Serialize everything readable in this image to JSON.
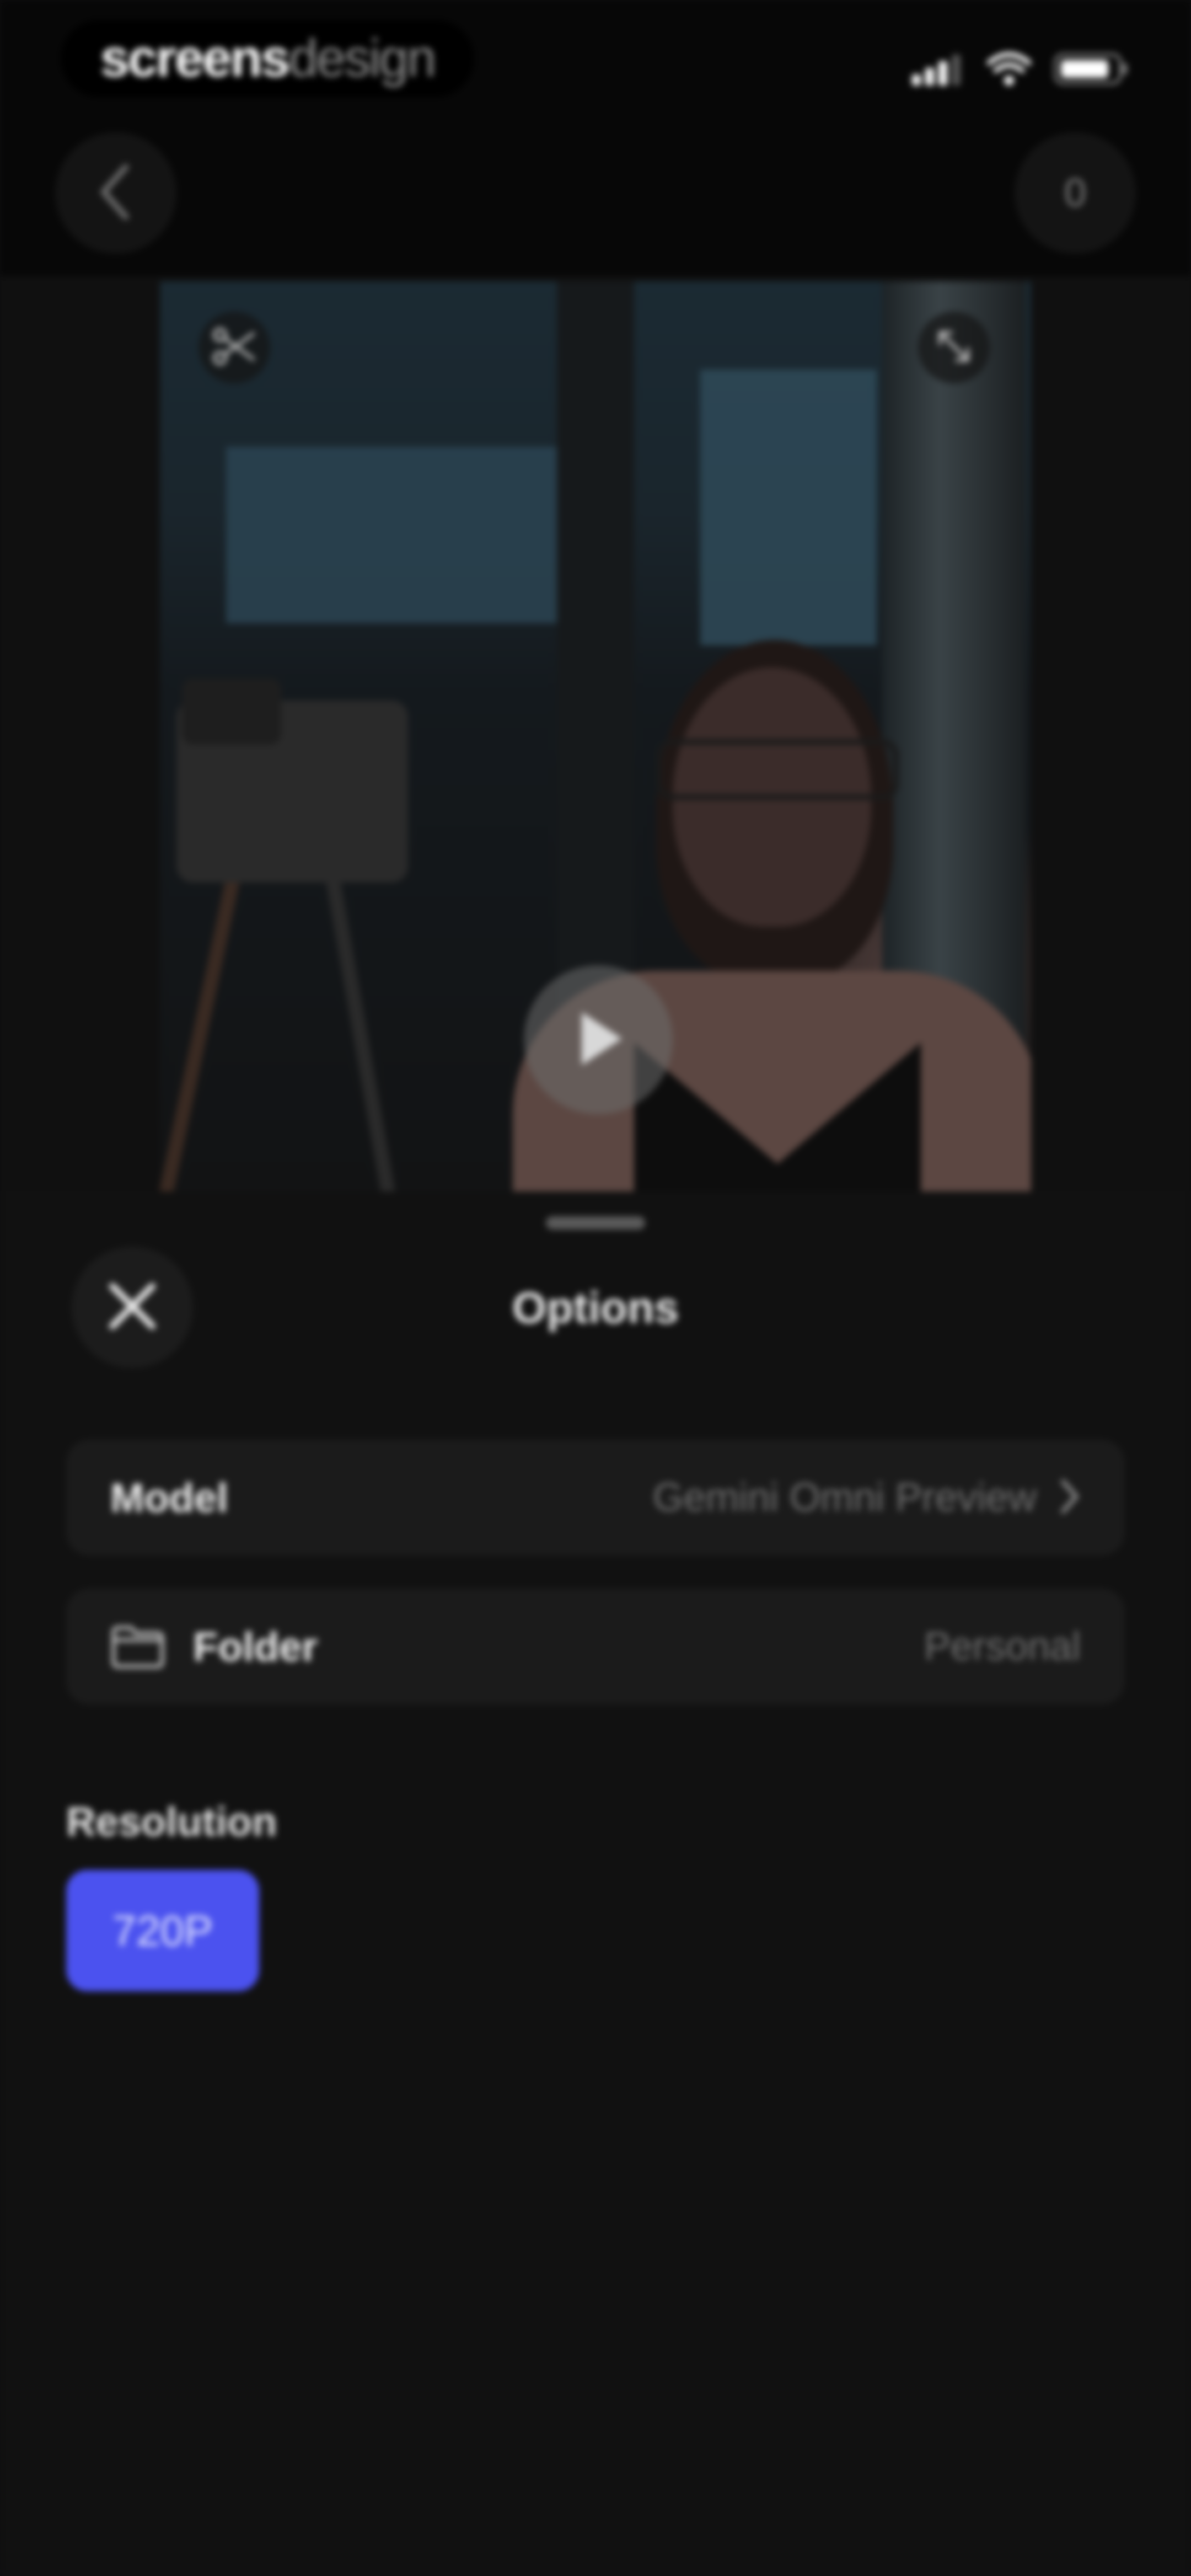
{
  "watermark": {
    "part_a": "screens",
    "part_b": "design"
  },
  "status_bar": {
    "icons": [
      "signal-icon",
      "wifi-icon",
      "battery-icon"
    ]
  },
  "nav": {
    "back_icon": "chevron-left-icon",
    "counter": "0"
  },
  "video": {
    "controls": [
      "scissors-icon",
      "expand-icon",
      "play-icon"
    ]
  },
  "sheet": {
    "title": "Options",
    "close_icon": "close-icon",
    "model": {
      "label": "Model",
      "value": "Gemini Omni Preview"
    },
    "folder": {
      "label": "Folder",
      "value": "Personal",
      "icon": "folder-icon"
    },
    "resolution": {
      "label": "Resolution",
      "selected": "720P"
    }
  },
  "colors": {
    "accent": "#4b52ef",
    "background": "#111111",
    "row_background": "#1b1b1b"
  }
}
